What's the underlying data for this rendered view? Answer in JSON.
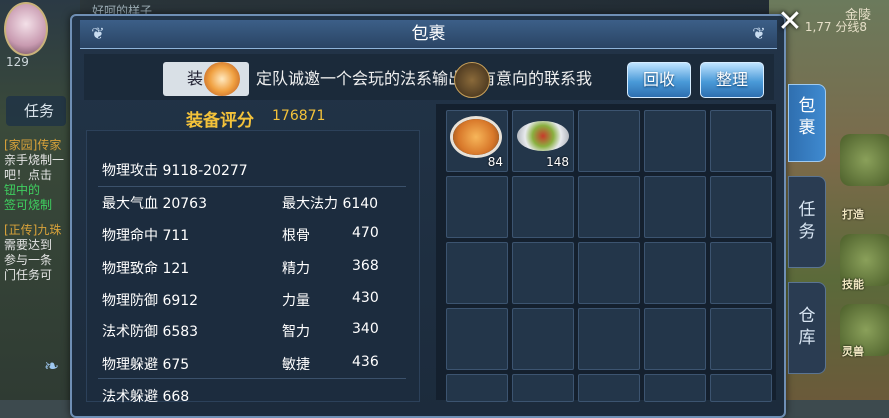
{
  "hud": {
    "player_name": "好呵的样子",
    "level": "129",
    "task_tab": "任务",
    "top_right_name": "金陵",
    "top_right_line": "1,77 分线8",
    "chat": [
      {
        "tag": "[家园]",
        "text": "传家"
      },
      {
        "tag": "",
        "text": "亲手烧制一"
      },
      {
        "tag": "",
        "text": "吧！点击"
      },
      {
        "tag": "",
        "text": "钮中的"
      },
      {
        "tag": "",
        "text": "签可烧制"
      },
      {
        "tag": "[正传]",
        "text": "九珠"
      },
      {
        "tag": "",
        "text": "需要达到"
      },
      {
        "tag": "",
        "text": "参与一条"
      },
      {
        "tag": "",
        "text": "门任务可"
      }
    ],
    "side_buttons": [
      "打造",
      "技能",
      "灵兽"
    ]
  },
  "panel": {
    "title": "包裹",
    "tab_equip": "装",
    "marquee": "定队诚邀一个会玩的法系输出，有意向的联系我",
    "btn_recycle": "回收",
    "btn_sort": "整理"
  },
  "score": {
    "label": "装备评分",
    "value": "176871"
  },
  "stats": {
    "attack": "物理攻击 9118-20277",
    "hp": "最大气血 20763",
    "mp": "最大法力 6140",
    "hit": "物理命中 711",
    "crit": "物理致命 121",
    "pdef": "物理防御 6912",
    "mdef": "法术防御 6583",
    "dodge": "物理躲避 675",
    "mdodge": "法术躲避 668",
    "attr": [
      {
        "name": "根骨",
        "value": "470"
      },
      {
        "name": "精力",
        "value": "368"
      },
      {
        "name": "力量",
        "value": "430"
      },
      {
        "name": "智力",
        "value": "340"
      },
      {
        "name": "敏捷",
        "value": "436"
      }
    ]
  },
  "bag": {
    "items": [
      {
        "name": "pie-food",
        "count": "84"
      },
      {
        "name": "plate-food",
        "count": "148"
      }
    ]
  },
  "vtabs": {
    "bag": [
      "包",
      "裹"
    ],
    "task": [
      "任",
      "务"
    ],
    "store": [
      "仓",
      "库"
    ]
  }
}
